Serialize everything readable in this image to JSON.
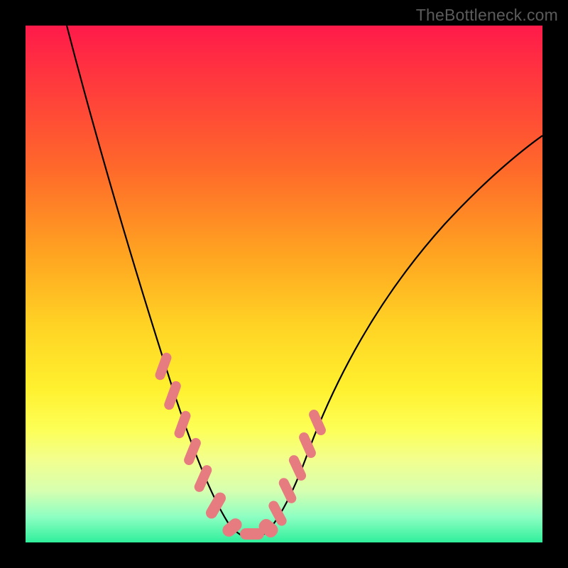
{
  "watermark": "TheBottleneck.com",
  "colors": {
    "background": "#000000",
    "gradient_top": "#ff1a4a",
    "gradient_bottom": "#30ef9c",
    "curve": "#000000",
    "markers": "#e77c80"
  },
  "chart_data": {
    "type": "line",
    "title": "",
    "xlabel": "",
    "ylabel": "",
    "xlim": [
      0,
      100
    ],
    "ylim": [
      0,
      100
    ],
    "note": "No axes or ticks are drawn; values are estimates read from curve geometry against the plot area. y=0 is bottom (green), y=100 is top (red). Curve is a V/U shape bottoming near x≈41.",
    "series": [
      {
        "name": "bottleneck-curve",
        "x": [
          8,
          12,
          16,
          20,
          24,
          28,
          30,
          32,
          34,
          36,
          38,
          40,
          42,
          44,
          46,
          48,
          50,
          54,
          60,
          68,
          78,
          90,
          100
        ],
        "y": [
          100,
          86,
          72,
          58,
          44,
          30,
          24,
          18,
          12,
          7,
          3,
          1,
          1,
          2,
          4,
          8,
          13,
          21,
          31,
          42,
          53,
          63,
          71
        ]
      }
    ],
    "markers": {
      "name": "highlighted-range",
      "description": "Salmon pill-shaped markers along the curve near the bottom of the V on both sides.",
      "points_x": [
        26.5,
        28.5,
        30.5,
        32.5,
        34.5,
        37,
        40,
        43.5,
        46,
        47.5,
        49,
        50.5,
        52,
        53.5
      ],
      "points_y": [
        35,
        28,
        22,
        16,
        10,
        4,
        1,
        1,
        5,
        9,
        13,
        17,
        21,
        25
      ]
    }
  }
}
